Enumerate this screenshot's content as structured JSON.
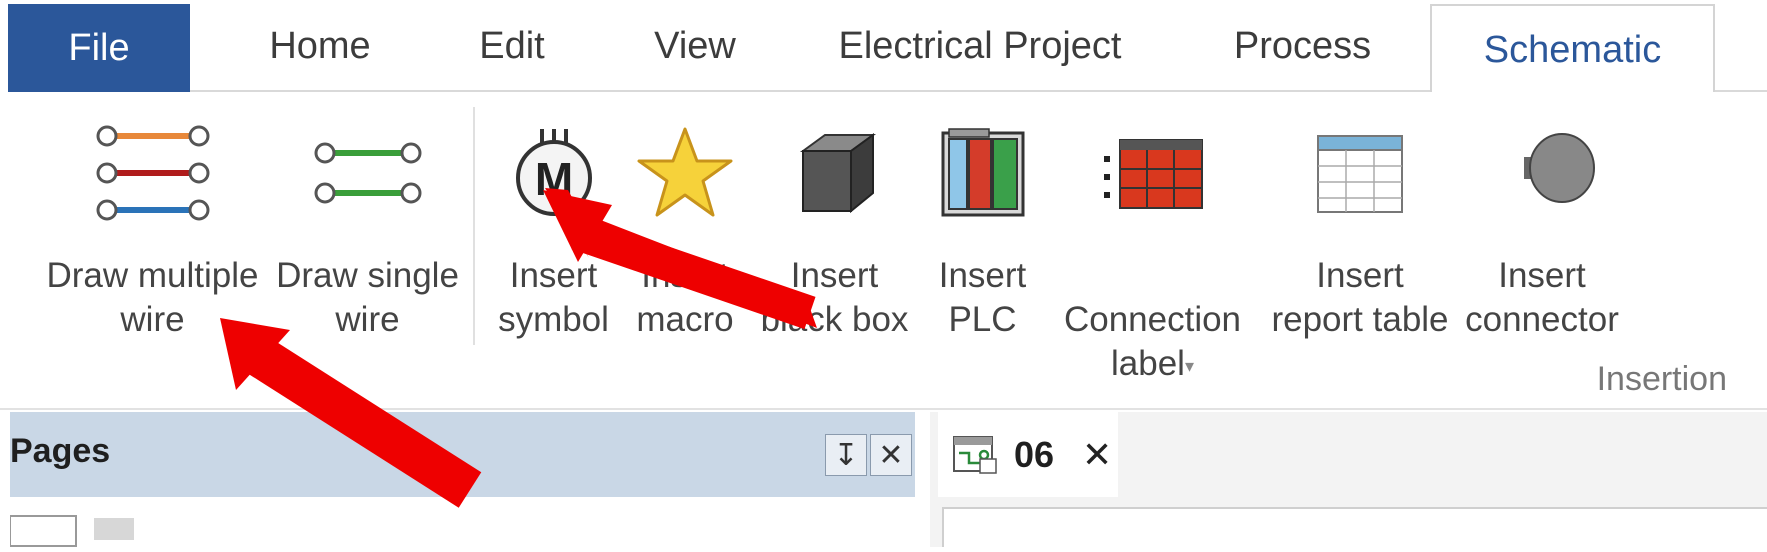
{
  "tabs": {
    "file": "File",
    "home": "Home",
    "edit": "Edit",
    "view": "View",
    "project": "Electrical Project",
    "process": "Process",
    "schematic": "Schematic"
  },
  "ribbon": {
    "draw_multiple_wire": "Draw multiple\nwire",
    "draw_single_wire": "Draw single\nwire",
    "insert_symbol": "Insert\nsymbol",
    "insert_macro": "Insert\nmacro",
    "insert_black_box": "Insert\nblack box",
    "insert_plc": "Insert\nPLC",
    "connection_label": "Connection\nlabel",
    "connection_label_dropdown": "▾",
    "insert_report_table": "Insert\nreport table",
    "insert_connector": "Insert\nconnector",
    "group_label": "Insertion"
  },
  "pages_panel": {
    "title": "Pages",
    "pin": "↧",
    "close": "✕"
  },
  "document": {
    "tab_label": "06",
    "close": "✕"
  },
  "colors": {
    "file_tab": "#2b579a",
    "schematic_tab_text": "#2b579a",
    "arrow": "#ee0000",
    "panel_header": "#c9d7e6"
  },
  "icons": [
    "multiple-wire-icon",
    "single-wire-icon",
    "motor-symbol-icon",
    "star-macro-icon",
    "black-box-icon",
    "plc-icon",
    "connection-label-icon",
    "report-table-icon",
    "connector-icon"
  ]
}
